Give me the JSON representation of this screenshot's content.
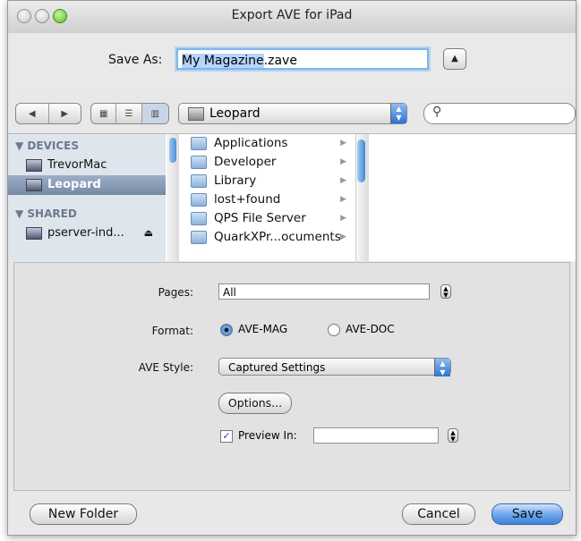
{
  "window": {
    "title": "Export AVE for iPad"
  },
  "saveas": {
    "label": "Save As:",
    "value_selected": "My Magazine",
    "value_ext": ".zave"
  },
  "toolbar": {
    "location": "Leopard",
    "search_placeholder": ""
  },
  "sidebar": {
    "devices_header": "DEVICES",
    "shared_header": "SHARED",
    "items": [
      {
        "label": "TrevorMac"
      },
      {
        "label": "Leopard"
      },
      {
        "label": "pserver-ind..."
      }
    ]
  },
  "column1": {
    "items": [
      {
        "label": "Applications"
      },
      {
        "label": "Developer"
      },
      {
        "label": "Library"
      },
      {
        "label": "lost+found"
      },
      {
        "label": "QPS File Server"
      },
      {
        "label": "QuarkXPr...ocuments"
      }
    ]
  },
  "options": {
    "pages_label": "Pages:",
    "pages_value": "All",
    "format_label": "Format:",
    "format_opt1": "AVE-MAG",
    "format_opt2": "AVE-DOC",
    "format_selected": "AVE-MAG",
    "style_label": "AVE Style:",
    "style_value": "Captured Settings",
    "options_button": "Options...",
    "preview_label": "Preview In:",
    "preview_checked": true,
    "preview_value": ""
  },
  "buttons": {
    "new_folder": "New Folder",
    "cancel": "Cancel",
    "save": "Save"
  },
  "colors": {
    "accent": "#3f82d9",
    "sidebar_selected": "#7589a6"
  }
}
